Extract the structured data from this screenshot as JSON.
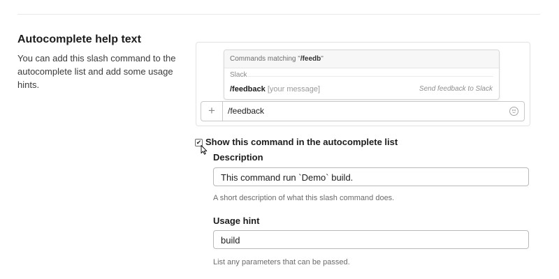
{
  "section": {
    "title": "Autocomplete help text",
    "description": "You can add this slash command to the autocomplete list and add some usage hints."
  },
  "preview": {
    "popup_header_prefix": "Commands matching \"",
    "popup_header_query": "/feedb",
    "popup_header_suffix": "\"",
    "group_label": "Slack",
    "item": {
      "command": "/feedback",
      "argument": "[your message]",
      "description": "Send feedback to Slack"
    },
    "composer": {
      "plus_glyph": "+",
      "text": "/feedback"
    }
  },
  "checkbox": {
    "label": "Show this command in the autocomplete list",
    "checked": true,
    "check_glyph": "✔"
  },
  "fields": {
    "description": {
      "label": "Description",
      "value": "This command run `Demo` build.",
      "help": "A short description of what this slash command does."
    },
    "usage_hint": {
      "label": "Usage hint",
      "value": "build",
      "help": "List any parameters that can be passed."
    }
  }
}
